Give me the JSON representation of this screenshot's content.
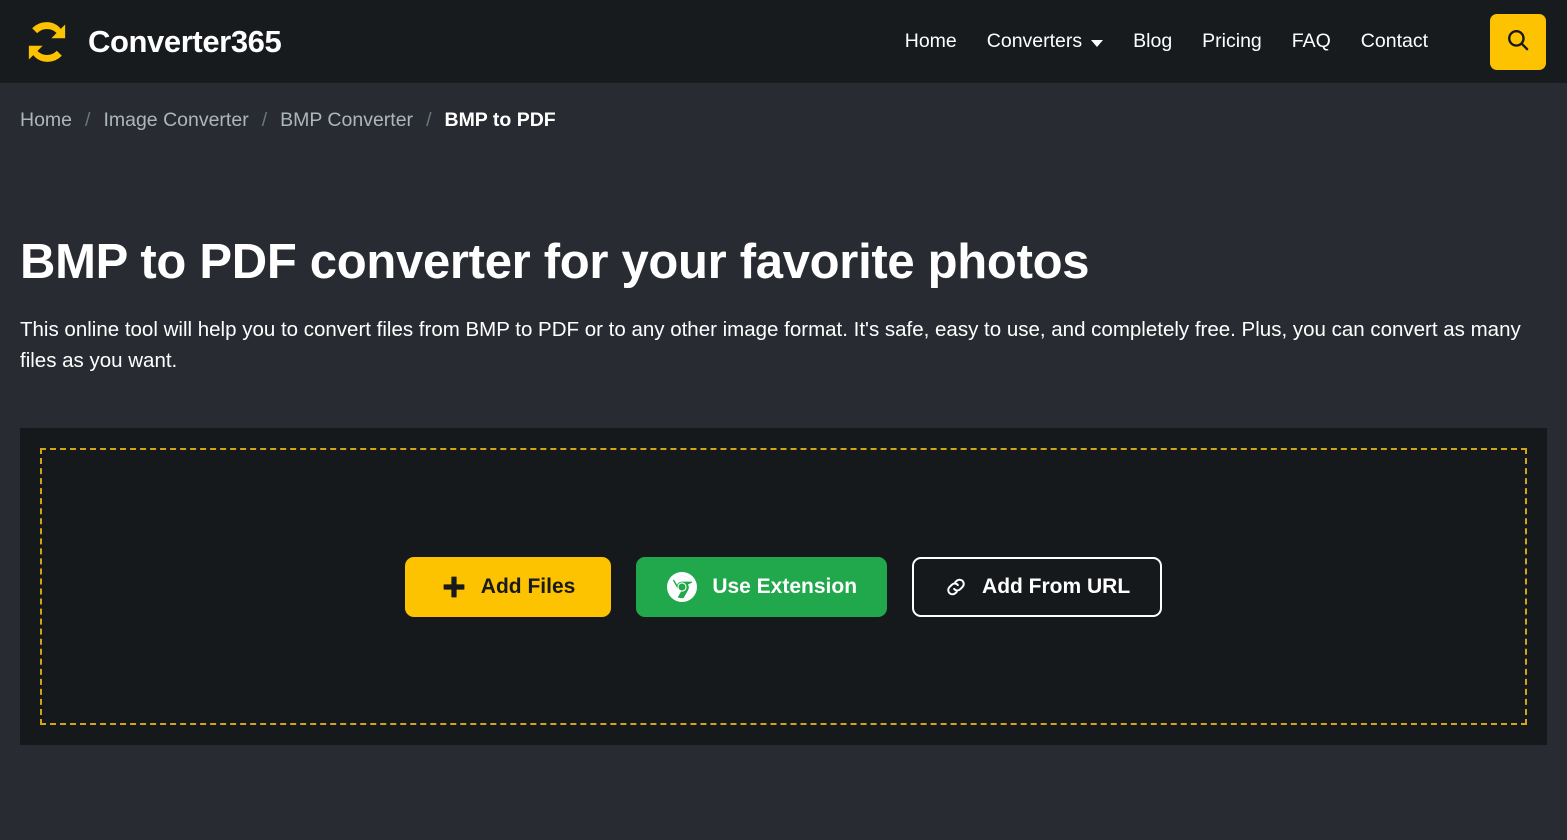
{
  "header": {
    "brand": {
      "name": "Converter365",
      "logo_icon": "sync-arrows-icon",
      "logo_color": "#fdc300"
    },
    "nav": [
      {
        "label": "Home",
        "icon": null
      },
      {
        "label": "Converters",
        "icon": "chevron-down-icon"
      },
      {
        "label": "Blog",
        "icon": null
      },
      {
        "label": "Pricing",
        "icon": null
      },
      {
        "label": "FAQ",
        "icon": null
      },
      {
        "label": "Contact",
        "icon": null
      }
    ],
    "search": {
      "icon": "search-icon",
      "background": "#fdc300"
    }
  },
  "breadcrumb": {
    "separator": "/",
    "items": [
      {
        "label": "Home",
        "active": false
      },
      {
        "label": "Image Converter",
        "active": false
      },
      {
        "label": "BMP Converter",
        "active": false
      },
      {
        "label": "BMP to PDF",
        "active": true
      }
    ]
  },
  "hero": {
    "title": "BMP to PDF converter for your favorite photos",
    "description": "This online tool will help you to convert files from BMP to PDF or to any other image format. It's safe, easy to use, and completely free. Plus, you can convert as many files as you want."
  },
  "dropzone": {
    "border_color": "#d2a517",
    "background": "#15191c",
    "buttons": [
      {
        "label": "Add Files",
        "icon": "plus-icon",
        "color": "#fdc300",
        "text_color": "#17191c"
      },
      {
        "label": "Use Extension",
        "icon": "chrome-icon",
        "color": "#22a84c",
        "text_color": "#ffffff"
      },
      {
        "label": "Add From URL",
        "icon": "link-icon",
        "color": "transparent",
        "text_color": "#ffffff"
      }
    ]
  },
  "theme": {
    "page_background": "#282c32",
    "header_background": "#171b1e",
    "accent": "#fdc300",
    "muted_text": "#adb5bd"
  }
}
